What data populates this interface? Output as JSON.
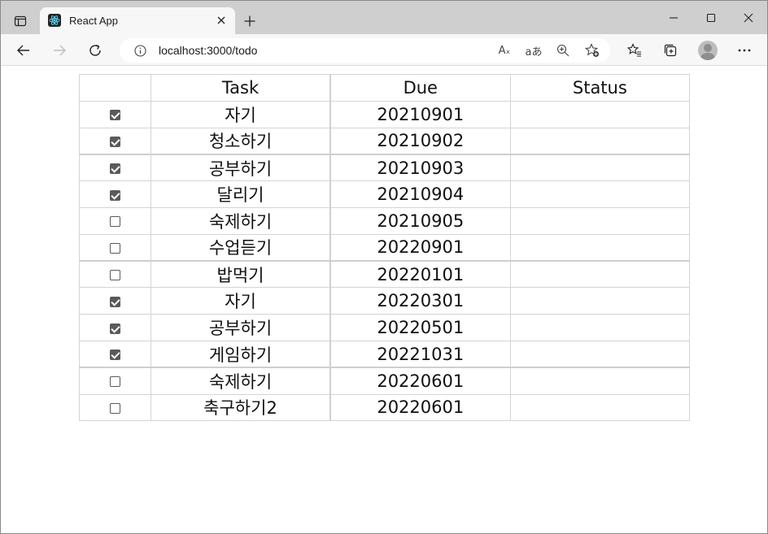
{
  "browser": {
    "tab_title": "React App",
    "url": "localhost:3000/todo",
    "icons": [
      "tab-actions-icon",
      "react-favicon-icon",
      "close-icon",
      "plus-icon",
      "minimize-icon",
      "maximize-icon",
      "window-close-icon",
      "back-icon",
      "forward-icon",
      "refresh-icon",
      "info-icon",
      "read-aloud-icon",
      "translate-icon",
      "zoom-icon",
      "add-favorite-icon",
      "favorites-icon",
      "collections-icon",
      "profile-icon",
      "more-icon"
    ],
    "read_aloud_glyph": "Aₓ",
    "translate_glyph": "aあ"
  },
  "table": {
    "headers": {
      "check": "",
      "task": "Task",
      "due": "Due",
      "status": "Status"
    },
    "rows": [
      {
        "checked": true,
        "task": "자기",
        "due": "20210901",
        "status": ""
      },
      {
        "checked": true,
        "task": "청소하기",
        "due": "20210902",
        "status": ""
      },
      {
        "checked": true,
        "task": "공부하기",
        "due": "20210903",
        "status": ""
      },
      {
        "checked": true,
        "task": "달리기",
        "due": "20210904",
        "status": ""
      },
      {
        "checked": false,
        "task": "숙제하기",
        "due": "20210905",
        "status": ""
      },
      {
        "checked": false,
        "task": "수업듣기",
        "due": "20220901",
        "status": ""
      },
      {
        "checked": false,
        "task": "밥먹기",
        "due": "20220101",
        "status": ""
      },
      {
        "checked": true,
        "task": "자기",
        "due": "20220301",
        "status": ""
      },
      {
        "checked": true,
        "task": "공부하기",
        "due": "20220501",
        "status": ""
      },
      {
        "checked": true,
        "task": "게임하기",
        "due": "20221031",
        "status": ""
      },
      {
        "checked": false,
        "task": "숙제하기",
        "due": "20220601",
        "status": ""
      },
      {
        "checked": false,
        "task": "축구하기2",
        "due": "20220601",
        "status": ""
      }
    ]
  },
  "colors": {
    "titlebar": "#cfcfcf",
    "toolbar": "#f7f7f7",
    "grid": "#d4d4d4",
    "checkbox": "#5a5a5a"
  }
}
